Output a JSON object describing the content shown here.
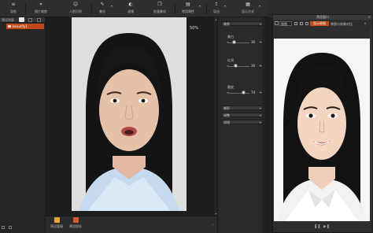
{
  "toolbar": {
    "items": [
      {
        "label": "导航",
        "icon": "navigation-icon"
      },
      {
        "label": "照片裁剪",
        "icon": "crop-icon"
      },
      {
        "label": "人脸识别",
        "icon": "face-detect-icon"
      },
      {
        "label": "美化",
        "icon": "beautify-icon"
      },
      {
        "label": "滤镜",
        "icon": "filter-icon"
      },
      {
        "label": "批量美化",
        "icon": "batch-icon"
      },
      {
        "label": "常用属性",
        "icon": "properties-icon"
      },
      {
        "label": "导出",
        "icon": "export-icon"
      },
      {
        "label": "显示方式",
        "icon": "display-mode-icon"
      }
    ]
  },
  "left_panel": {
    "title": "预设列表",
    "item": "beautify1"
  },
  "canvas": {
    "zoom": "50%"
  },
  "bottom_bar": {
    "buttons": [
      {
        "label": "预设管理",
        "color": "#e8a53a"
      },
      {
        "label": "预设保存",
        "color": "#d9582a"
      }
    ]
  },
  "adjust_panel": {
    "section_main": "美颜",
    "sliders": [
      {
        "name": "美白",
        "value": "30",
        "level": 0.3
      },
      {
        "name": "红润",
        "value": "36",
        "level": 0.36
      },
      {
        "name": "磨皮",
        "value": "74",
        "level": 0.74
      }
    ],
    "sections": [
      "美形",
      "调整",
      "滤镜"
    ]
  },
  "compare_window": {
    "title": "预览窗口",
    "mode": "原图",
    "active_label": "显示原图",
    "compare_label": "原图与效果对比"
  },
  "colors": {
    "accent": "#c24a1a",
    "panel_bg": "#2b2b2b"
  }
}
